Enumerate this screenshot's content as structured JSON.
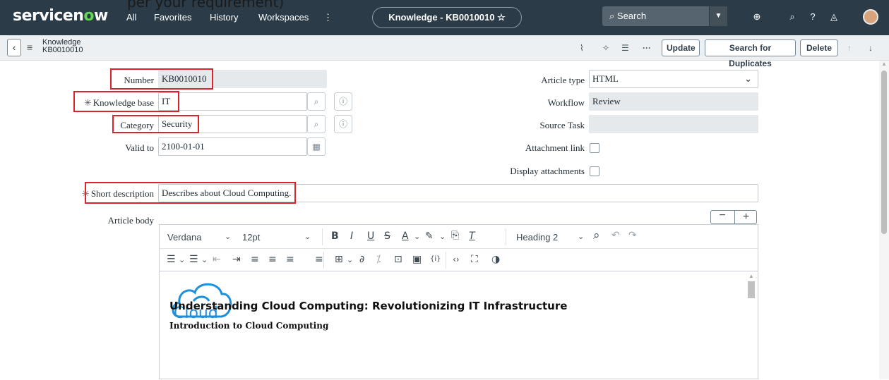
{
  "caption": "per your requirement)",
  "nav": {
    "logo_prefix": "servicen",
    "logo_o": "o",
    "logo_suffix": "w",
    "links": [
      "All",
      "Favorites",
      "History",
      "Workspaces",
      "⋮"
    ],
    "record_title": "Knowledge - KB0010010 ☆",
    "search_placeholder": "Search"
  },
  "header": {
    "title_line1": "Knowledge",
    "title_line2": "KB0010010",
    "buttons": {
      "update": "Update",
      "duplicates": "Search for Duplicates",
      "delete": "Delete"
    }
  },
  "form": {
    "number_label": "Number",
    "number_value": "KB0010010",
    "kb_label": "Knowledge base",
    "kb_value": "IT",
    "category_label": "Category",
    "category_value": "Security",
    "valid_to_label": "Valid to",
    "valid_to_value": "2100-01-01",
    "article_type_label": "Article type",
    "article_type_value": "HTML",
    "workflow_label": "Workflow",
    "workflow_value": "Review",
    "source_task_label": "Source Task",
    "source_task_value": "",
    "attachment_link_label": "Attachment link",
    "display_attachments_label": "Display attachments",
    "short_desc_label": "Short description",
    "short_desc_value": "Describes about Cloud Computing.",
    "article_body_label": "Article body",
    "required_mark": "✳"
  },
  "editor": {
    "font": "Verdana",
    "size": "12pt",
    "block": "Heading 2",
    "logo_text": "Cloud",
    "heading": "Understanding Cloud Computing: Revolutionizing IT Infrastructure",
    "subheading": "Introduction to Cloud Computing"
  },
  "colors": {
    "navbar": "#2b3b47",
    "highlight": "#d9232d",
    "logo_accent": "#62d84e",
    "cloud_blue": "#1e8fd9"
  }
}
